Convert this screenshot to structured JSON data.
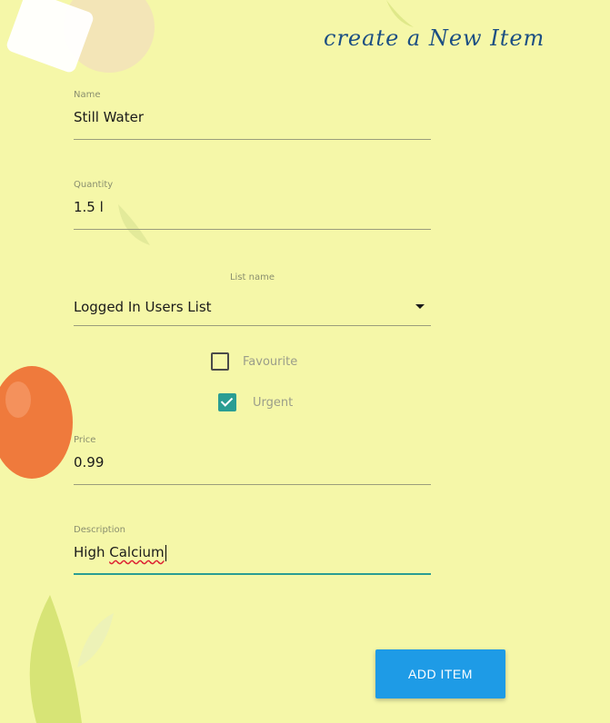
{
  "page": {
    "title": "create a New Item"
  },
  "form": {
    "name": {
      "label": "Name",
      "value": "Still Water"
    },
    "quantity": {
      "label": "Quantity",
      "value": "1.5 l"
    },
    "list_name": {
      "label": "List name",
      "value": "Logged In Users List"
    },
    "favourite": {
      "label": "Favourite",
      "checked": false
    },
    "urgent": {
      "label": "Urgent",
      "checked": true
    },
    "price": {
      "label": "Price",
      "value": "0.99"
    },
    "description": {
      "label": "Description",
      "value_start": "High ",
      "value_misspelled": "Calcium"
    }
  },
  "actions": {
    "add_item_label": "ADD ITEM"
  },
  "colors": {
    "accent": "#2a9d93",
    "button": "#1e9be6",
    "title": "#1c4f83",
    "background": "#f5f7a8"
  }
}
